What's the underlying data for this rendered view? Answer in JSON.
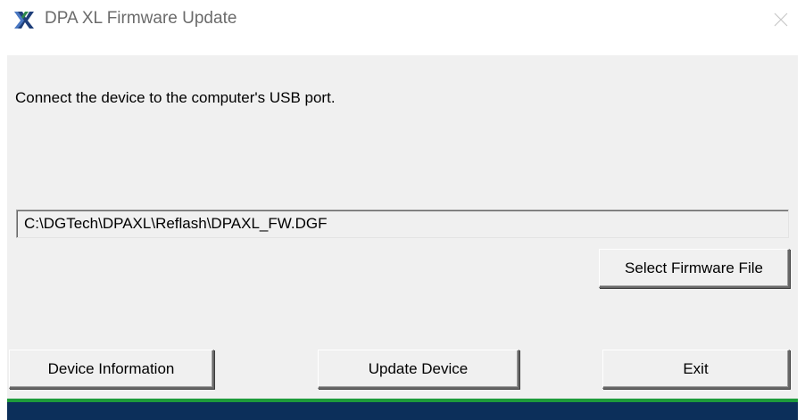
{
  "window": {
    "title": "DPA XL Firmware Update",
    "icon": "dpa-xl-app-icon",
    "close_icon": "close-icon"
  },
  "main": {
    "instruction": "Connect the device to the computer's USB port.",
    "firmware_path": "C:\\DGTech\\DPAXL\\Reflash\\DPAXL_FW.DGF"
  },
  "buttons": {
    "select_firmware": "Select Firmware File",
    "device_information": "Device Information",
    "update_device": "Update Device",
    "exit": "Exit"
  },
  "progress": {
    "fraction": 1.0,
    "fill_color": "#1e9b3b",
    "track_color": "#0c2f5a"
  },
  "colors": {
    "client_bg": "#f0f0f0",
    "title_text": "#6b6b6b"
  }
}
